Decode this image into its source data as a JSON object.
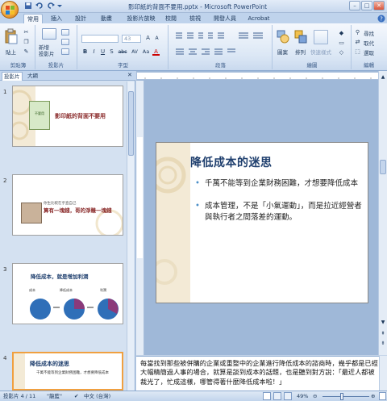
{
  "window": {
    "title": "影印紙的背面不要用.pptx - Microsoft PowerPoint",
    "minimize": "–",
    "maximize": "□",
    "close": "✕",
    "help": "?"
  },
  "tabs": [
    "常用",
    "插入",
    "設計",
    "動畫",
    "投影片放映",
    "校閱",
    "檢視",
    "開發人員",
    "Acrobat"
  ],
  "ribbon": {
    "groups": {
      "clipboard": {
        "label": "剪貼簿",
        "paste": "貼上"
      },
      "slides": {
        "label": "投影片",
        "new_slide": "新增\n投影片"
      },
      "font": {
        "label": "字型",
        "font_name": "",
        "font_size": "43",
        "buttons": [
          "B",
          "I",
          "U",
          "S",
          "abc",
          "AV",
          "Aa",
          "A"
        ]
      },
      "paragraph": {
        "label": "段落"
      },
      "drawing": {
        "label": "繪圖",
        "shapes": "圖案",
        "arrange": "排列",
        "quick_styles": "快速樣式"
      },
      "editing": {
        "label": "編輯",
        "find": "尋找",
        "replace": "取代",
        "select": "選取"
      }
    }
  },
  "panel": {
    "tabs": [
      "投影片",
      "大綱"
    ],
    "close": "✕"
  },
  "thumbnails": [
    {
      "num": "1",
      "title": "影印紙的背面不要用",
      "book_title": "不要用"
    },
    {
      "num": "2",
      "small": "你生比較在乎直自己",
      "quote": "算有一塊錢，哥的淨賺一塊錢"
    },
    {
      "num": "3",
      "title": "降低成本，就是增加利潤",
      "labels": [
        "成本",
        "降低成本",
        "利潤"
      ]
    },
    {
      "num": "4",
      "title": "降低成本的迷思",
      "bullet": "千萬不能等到企業財務困難，才想要降低成本"
    }
  ],
  "slide": {
    "title": "降低成本的迷思",
    "bullets": [
      "千萬不能等到企業財務困難，才想要降低成本",
      "成本管理，不是「小氣運動」，而是拉近經營者與執行者之間落差的運動。"
    ]
  },
  "notes": {
    "text": "每當找到那些被併購的企業或重整中的企業進行降低成本的諮商時，幾乎都是已經大幅精簡過人事的場合，就算是談到成本的話題，也是聽到對方說：「最近人都被裁光了，忙成這樣，哪管得著什麼降低成本啦！」"
  },
  "status": {
    "slide_info": "投影片 4 / 11",
    "theme": "\"龍藍\"",
    "language": "中文 (台灣)",
    "zoom": "49%"
  },
  "colors": {
    "accent": "#3b5d8f",
    "slide_bullet": "#4b8fc8",
    "slide_title": "#1f3f6e",
    "chart_blue": "#2f6fb8"
  }
}
